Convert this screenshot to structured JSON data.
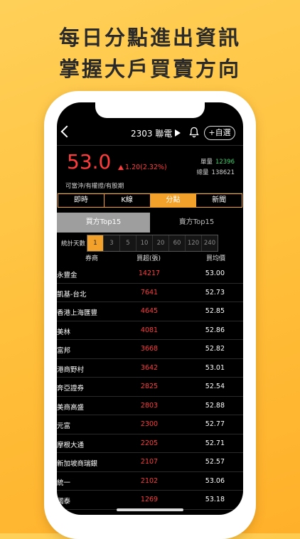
{
  "promo": {
    "headline1": "每日分點進出資訊",
    "headline2": "掌握大戶買賣方向"
  },
  "nav": {
    "title": "2303 聯電",
    "watch_label": "+自選"
  },
  "quote": {
    "price": "53.0",
    "change": "1.20(2.32%)",
    "tags": "可當沖/有權證/有股期",
    "single_label": "單量",
    "single_value": "12396",
    "total_label": "總量",
    "total_value": "138621"
  },
  "tabs": [
    "即時",
    "K線",
    "分點",
    "新聞"
  ],
  "subtabs": [
    "買方Top15",
    "賣方Top15"
  ],
  "days": {
    "label": "統計天數",
    "options": [
      "1",
      "3",
      "5",
      "10",
      "20",
      "60",
      "120",
      "240"
    ]
  },
  "table": {
    "headers": [
      "券商",
      "買超(張)",
      "買均價"
    ],
    "rows": [
      {
        "broker": "永豐金",
        "qty": "14217",
        "price": "53.00"
      },
      {
        "broker": "凱基-台北",
        "qty": "7641",
        "price": "52.73"
      },
      {
        "broker": "香港上海匯豐",
        "qty": "4645",
        "price": "52.85"
      },
      {
        "broker": "美林",
        "qty": "4081",
        "price": "52.86"
      },
      {
        "broker": "富邦",
        "qty": "3668",
        "price": "52.82"
      },
      {
        "broker": "港商野村",
        "qty": "3642",
        "price": "53.01"
      },
      {
        "broker": "奔亞證券",
        "qty": "2825",
        "price": "52.54"
      },
      {
        "broker": "美商高盛",
        "qty": "2803",
        "price": "52.88"
      },
      {
        "broker": "元富",
        "qty": "2300",
        "price": "52.77"
      },
      {
        "broker": "摩根大通",
        "qty": "2205",
        "price": "52.71"
      },
      {
        "broker": "新加坡商瑞銀",
        "qty": "2107",
        "price": "52.57"
      },
      {
        "broker": "統一",
        "qty": "2102",
        "price": "53.06"
      },
      {
        "broker": "國泰",
        "qty": "1269",
        "price": "53.18"
      }
    ]
  }
}
